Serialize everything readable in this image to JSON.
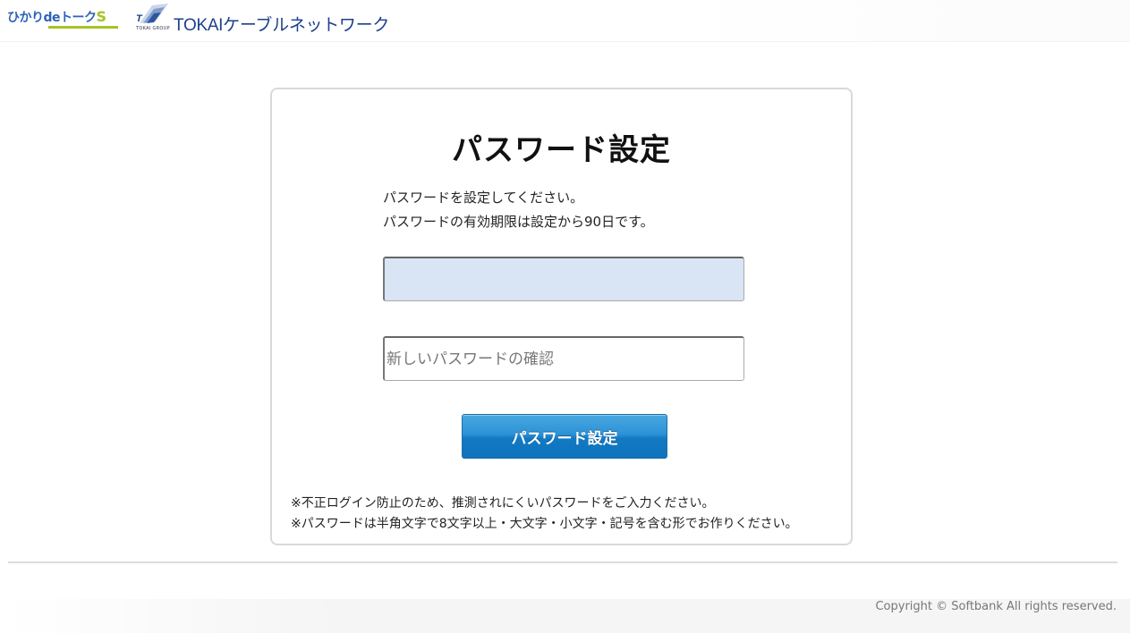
{
  "header": {
    "logo_hikari_text": "ひかりdeトーク",
    "logo_hikari_suffix": "S",
    "logo_tokai_group": "TOKAI GROUP",
    "logo_tokai_name": "TOKAIケーブルネットワーク"
  },
  "card": {
    "title": "パスワード設定",
    "description": [
      "パスワードを設定してください。",
      "パスワードの有効期限は設定から90日です。"
    ],
    "password_field": {
      "value": "",
      "placeholder": ""
    },
    "confirm_field": {
      "value": "",
      "placeholder": "新しいパスワードの確認"
    },
    "submit_label": "パスワード設定",
    "notes": [
      "※不正ログイン防止のため、推測されにくいパスワードをご入力ください。",
      "※パスワードは半角文字で8文字以上・大文字・小文字・記号を含む形でお作りください。"
    ]
  },
  "footer": {
    "copyright": "Copyright © Softbank All rights reserved."
  },
  "colors": {
    "accent": "#1a84cc",
    "field_focus_bg": "#d9e4f4",
    "logo_blue": "#1d3f8c",
    "logo_green": "#a5c423"
  }
}
